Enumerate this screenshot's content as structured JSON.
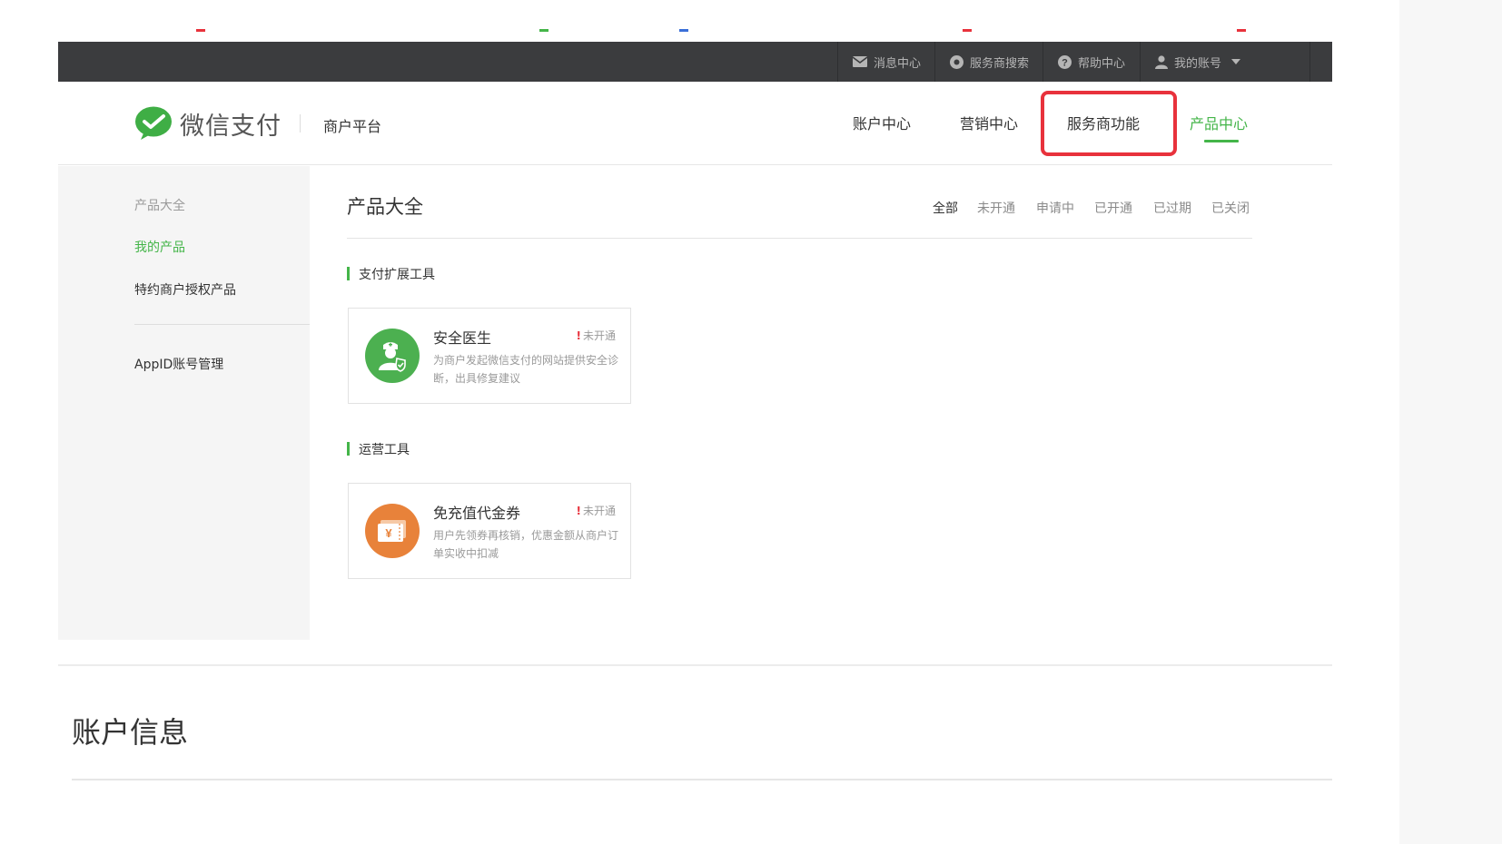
{
  "topbar": {
    "items": [
      {
        "label": "消息中心",
        "icon": "mail-icon"
      },
      {
        "label": "服务商搜索",
        "icon": "search-circle-icon"
      },
      {
        "label": "帮助中心",
        "icon": "help-icon"
      },
      {
        "label": "我的账号",
        "icon": "user-icon"
      }
    ]
  },
  "header": {
    "logo_text": "微信支付",
    "platform": "商户平台",
    "nav": [
      {
        "label": "账户中心"
      },
      {
        "label": "营销中心"
      },
      {
        "label": "服务商功能"
      },
      {
        "label": "产品中心"
      }
    ],
    "active_nav": "产品中心",
    "highlighted_nav": "服务商功能"
  },
  "sidebar": {
    "items": [
      {
        "label": "产品大全"
      },
      {
        "label": "我的产品"
      },
      {
        "label": "特约商户授权产品"
      },
      {
        "label": "AppID账号管理"
      }
    ],
    "active": "我的产品"
  },
  "main": {
    "title": "产品大全",
    "filters": [
      "全部",
      "未开通",
      "申请中",
      "已开通",
      "已过期",
      "已关闭"
    ],
    "active_filter": "全部",
    "sections": [
      {
        "label": "支付扩展工具",
        "card": {
          "title": "安全医生",
          "status": "未开通",
          "description": "为商户发起微信支付的网站提供安全诊断，出具修复建议",
          "icon": "doctor-shield-icon",
          "icon_color": "#4cb050"
        }
      },
      {
        "label": "运营工具",
        "card": {
          "title": "免充值代金券",
          "status": "未开通",
          "description": "用户先领券再核销，优惠金额从商户订单实收中扣减",
          "icon": "voucher-yen-icon",
          "icon_color": "#e8823a"
        }
      }
    ]
  },
  "account": {
    "title": "账户信息"
  },
  "colors": {
    "brand_green": "#44b549",
    "topbar_bg": "#3b3c3e",
    "highlight_red": "#e8323c"
  }
}
